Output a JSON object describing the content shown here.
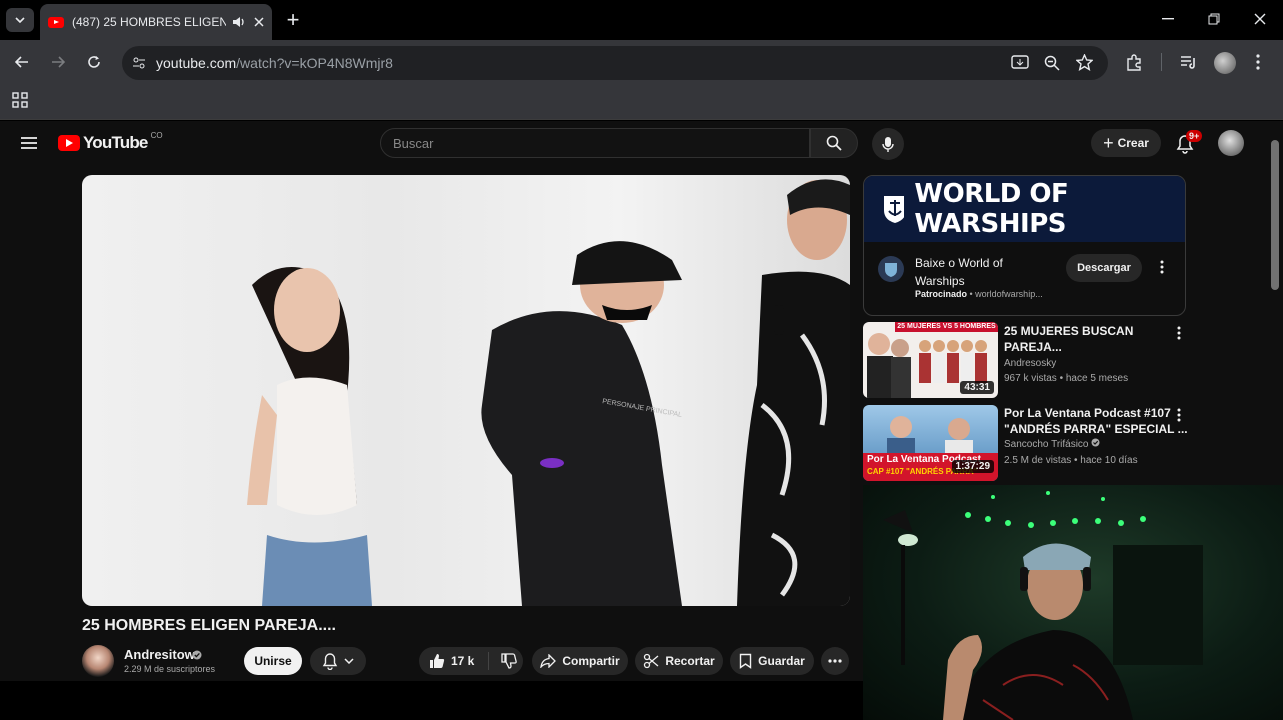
{
  "browser": {
    "tab_title": "(487) 25 HOMBRES ELIGEN",
    "url_host": "youtube.com",
    "url_path": "/watch?v=kOP4N8Wmjr8"
  },
  "youtube": {
    "logo_text": "YouTube",
    "country_code": "CO",
    "search_placeholder": "Buscar",
    "create_label": "Crear",
    "notification_badge": "9+"
  },
  "video": {
    "title": "25 HOMBRES ELIGEN PAREJA....",
    "channel_name": "Andresitow",
    "subscribers": "2.29 M de suscriptores",
    "join_label": "Unirse",
    "likes": "17 k",
    "share_label": "Compartir",
    "clip_label": "Recortar",
    "save_label": "Guardar"
  },
  "ad": {
    "brand_banner": "WORLD OF WARSHIPS",
    "title": "Baixe o World of Warships",
    "sponsored": "Patrocinado",
    "domain": "worldofwarship...",
    "cta_label": "Descargar"
  },
  "recommendations": [
    {
      "title_line1": "25 MUJERES BUSCAN",
      "title_line2": "PAREJA...",
      "channel": "Andresosky",
      "meta": "967 k vistas • hace 5 meses",
      "duration": "43:31",
      "thumb_caption": "25 MUJERES VS 5 HOMBRES"
    },
    {
      "title_line1": "Por La Ventana Podcast #107",
      "title_line2": "\"ANDRÉS PARRA\" ESPECIAL ...",
      "channel": "Sancocho Trifásico",
      "meta": "2.5 M de vistas • hace 10 días",
      "duration": "1:37:29",
      "thumb_caption": "Por La Ventana Podcast",
      "thumb_caption2": "CAP #107 \"ANDRÉS PARRA\""
    }
  ],
  "video_shirt_text": "PERSONAJE PRINCIPAL",
  "colors": {
    "yt_red": "#ff0000",
    "bg": "#0f0f0f",
    "chrome": "#35363a"
  }
}
